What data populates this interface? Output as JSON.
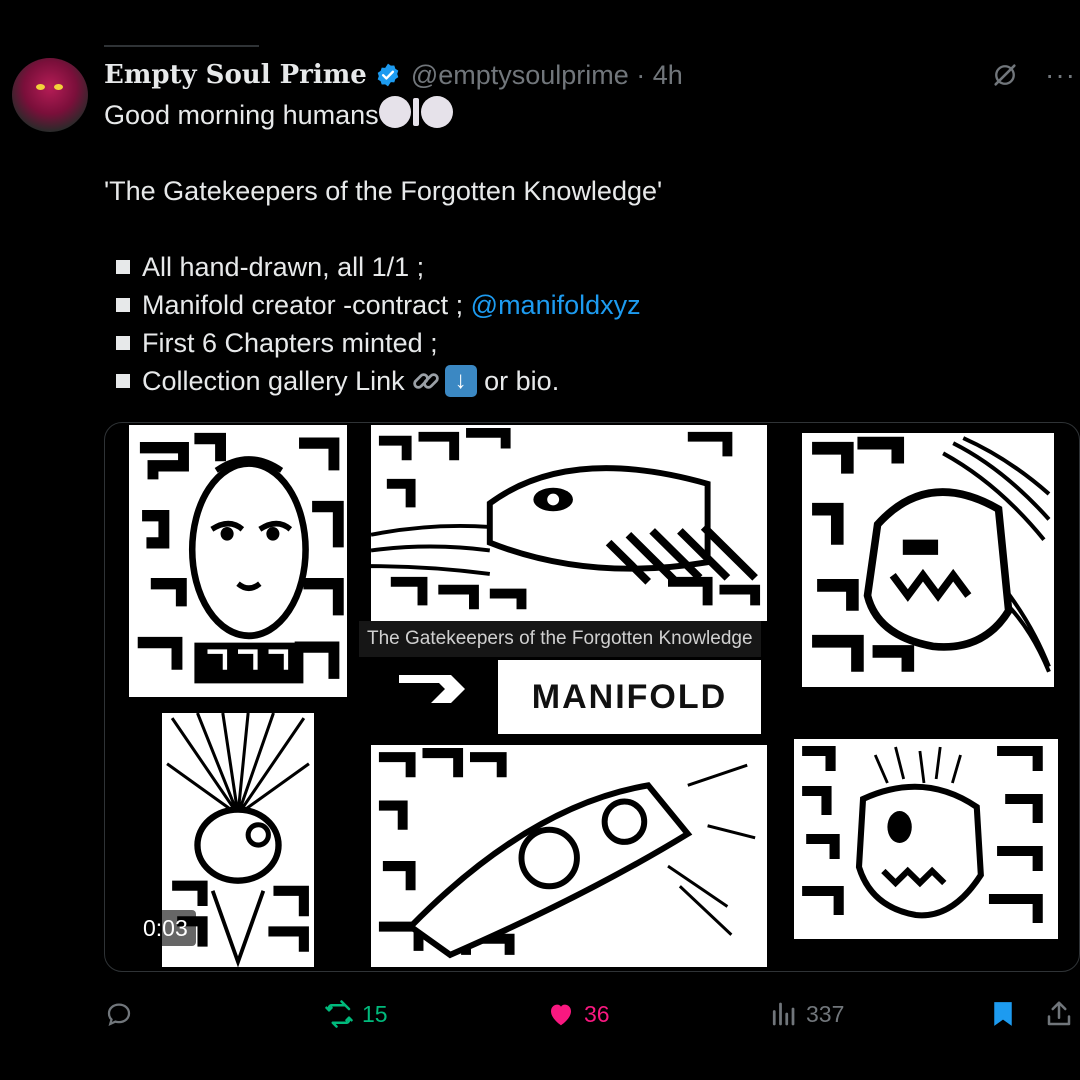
{
  "post": {
    "display_name": "Empty Soul Prime",
    "handle_time": "@emptysoulprime · 4h",
    "line1": "Good morning humans",
    "title_line": "'The Gatekeepers of the Forgotten Knowledge'",
    "bullets": [
      {
        "text": "All hand-drawn, all 1/1 ;"
      },
      {
        "text": "Manifold creator -contract ;",
        "mention": "@manifoldxyz"
      },
      {
        "text": "First 6 Chapters minted ;"
      },
      {
        "text": "Collection gallery Link",
        "after": "or bio."
      }
    ]
  },
  "media": {
    "caption": "The Gatekeepers of the Forgotten Knowledge",
    "brand": "MANIFOLD",
    "timestamp": "0:03"
  },
  "actions": {
    "reply_icon": "reply-icon",
    "retweets": "15",
    "likes": "36",
    "views": "337"
  },
  "colors": {
    "background": "#000000",
    "text": "#e7e9ea",
    "muted": "#71767b",
    "link": "#1d9bf0",
    "retweet": "#00ba7c",
    "like": "#f91880",
    "verified": "#1d9bf0"
  }
}
